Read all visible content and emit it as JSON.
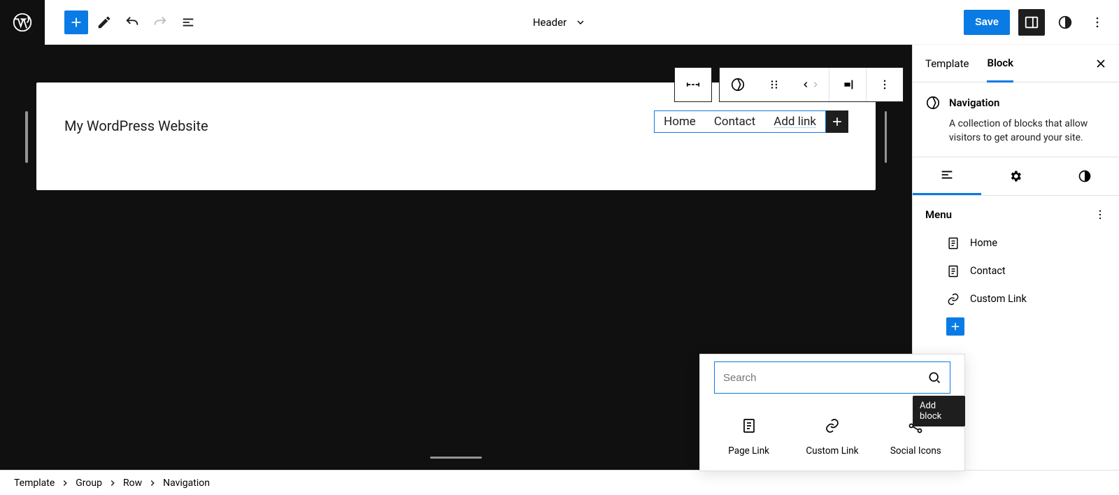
{
  "topbar": {
    "center_label": "Header",
    "save_label": "Save"
  },
  "canvas": {
    "site_title": "My WordPress Website",
    "nav": {
      "items": [
        "Home",
        "Contact"
      ],
      "add_label": "Add link"
    }
  },
  "sidebar": {
    "tabs": {
      "template": "Template",
      "block": "Block"
    },
    "block": {
      "name": "Navigation",
      "description": "A collection of blocks that allow visitors to get around your site."
    },
    "menu": {
      "title": "Menu",
      "items": [
        "Home",
        "Contact",
        "Custom Link"
      ]
    },
    "tooltip": "Add block"
  },
  "inserter": {
    "search_placeholder": "Search",
    "items": [
      "Page Link",
      "Custom Link",
      "Social Icons"
    ]
  },
  "breadcrumb": [
    "Template",
    "Group",
    "Row",
    "Navigation"
  ]
}
